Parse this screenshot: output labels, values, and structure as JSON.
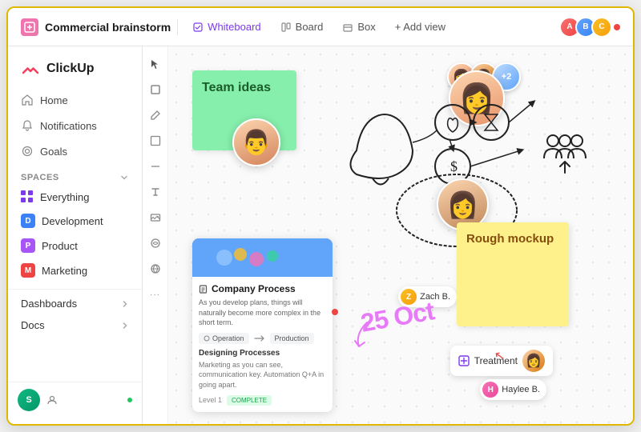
{
  "app": {
    "name": "ClickUp"
  },
  "header": {
    "title": "Commercial brainstorm",
    "tabs": [
      {
        "id": "whiteboard",
        "label": "Whiteboard",
        "active": true
      },
      {
        "id": "board",
        "label": "Board",
        "active": false
      },
      {
        "id": "box",
        "label": "Box",
        "active": false
      }
    ],
    "add_view": "+ Add view"
  },
  "sidebar": {
    "nav": [
      {
        "id": "home",
        "label": "Home"
      },
      {
        "id": "notifications",
        "label": "Notifications"
      },
      {
        "id": "goals",
        "label": "Goals"
      }
    ],
    "spaces_label": "Spaces",
    "spaces": [
      {
        "id": "everything",
        "label": "Everything"
      },
      {
        "id": "development",
        "label": "Development",
        "color": "#3b82f6"
      },
      {
        "id": "product",
        "label": "Product",
        "color": "#a855f7"
      },
      {
        "id": "marketing",
        "label": "Marketing",
        "color": "#ef4444"
      }
    ],
    "bottom": [
      {
        "id": "dashboards",
        "label": "Dashboards"
      },
      {
        "id": "docs",
        "label": "Docs"
      }
    ],
    "user": {
      "label": "S"
    }
  },
  "canvas": {
    "sticky_green": "Team ideas",
    "sticky_yellow": "Rough mockup",
    "process_card": {
      "title": "Company Process",
      "text": "As you develop plans, things will naturally become more complex in the short term.",
      "tag1": "Operation",
      "tag2": "Production",
      "section": "Designing Processes",
      "desc": "Marketing as you can see, communication key. Automation Q+A in going apart.",
      "status": "Level 1",
      "tag_complete": "COMPLETE"
    },
    "date_text": "25 Oct",
    "person_labels": [
      {
        "name": "Zach B."
      },
      {
        "name": "Haylee B."
      }
    ],
    "treatment_label": "Treatment"
  },
  "tools": [
    {
      "id": "pointer",
      "symbol": "↖"
    },
    {
      "id": "pen",
      "symbol": "✏"
    },
    {
      "id": "pencil",
      "symbol": "✏"
    },
    {
      "id": "rectangle",
      "symbol": "⬜"
    },
    {
      "id": "line",
      "symbol": "⟋"
    },
    {
      "id": "text",
      "symbol": "T"
    },
    {
      "id": "image",
      "symbol": "⊞"
    },
    {
      "id": "connector",
      "symbol": "⬡"
    },
    {
      "id": "globe",
      "symbol": "⊕"
    },
    {
      "id": "more",
      "symbol": "•••"
    }
  ]
}
